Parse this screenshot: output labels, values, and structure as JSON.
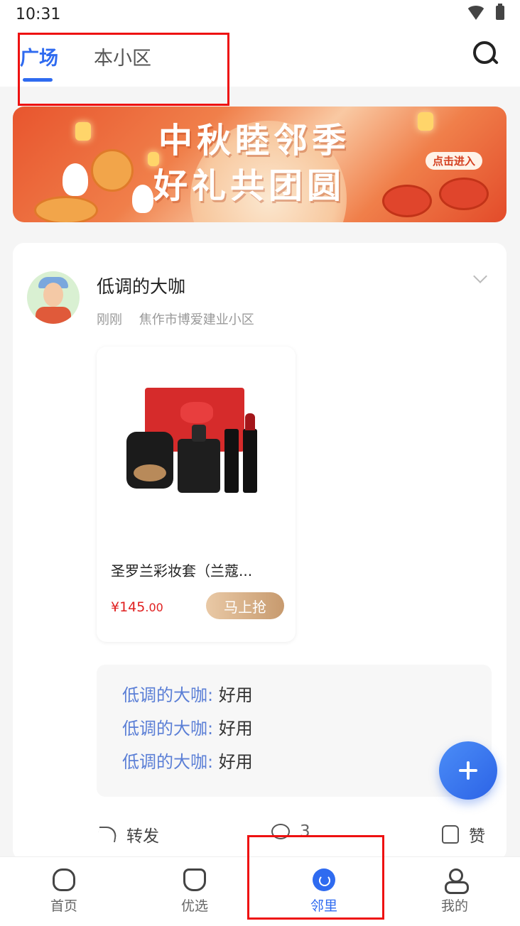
{
  "status_bar": {
    "time": "10:31"
  },
  "top_tabs": [
    {
      "label": "广场",
      "active": true
    },
    {
      "label": "本小区",
      "active": false
    }
  ],
  "banner": {
    "title_line1": "中秋睦邻季",
    "title_line2": "好礼共团圆",
    "enter_label": "点击进入"
  },
  "post": {
    "author": "低调的大咖",
    "time": "刚刚",
    "location": "焦作市博爱建业小区",
    "product": {
      "name": "圣罗兰彩妆套（兰蔻...",
      "price_main": "¥145",
      "price_cents": ".00",
      "buy_label": "马上抢"
    },
    "comments": [
      {
        "author": "低调的大咖:",
        "text": " 好用"
      },
      {
        "author": "低调的大咖:",
        "text": " 好用"
      },
      {
        "author": "低调的大咖:",
        "text": " 好用"
      }
    ],
    "actions": {
      "share_label": "转发",
      "comment_count": "3",
      "like_label": "赞"
    }
  },
  "bottom_nav": [
    {
      "label": "首页",
      "icon": "home-icon"
    },
    {
      "label": "优选",
      "icon": "bag-icon"
    },
    {
      "label": "邻里",
      "icon": "neighbor-icon",
      "active": true
    },
    {
      "label": "我的",
      "icon": "user-icon"
    }
  ],
  "colors": {
    "accent": "#2f6bf0",
    "price": "#e02020",
    "comment_author": "#5b7fd6",
    "highlight_box": "#ee1111"
  }
}
